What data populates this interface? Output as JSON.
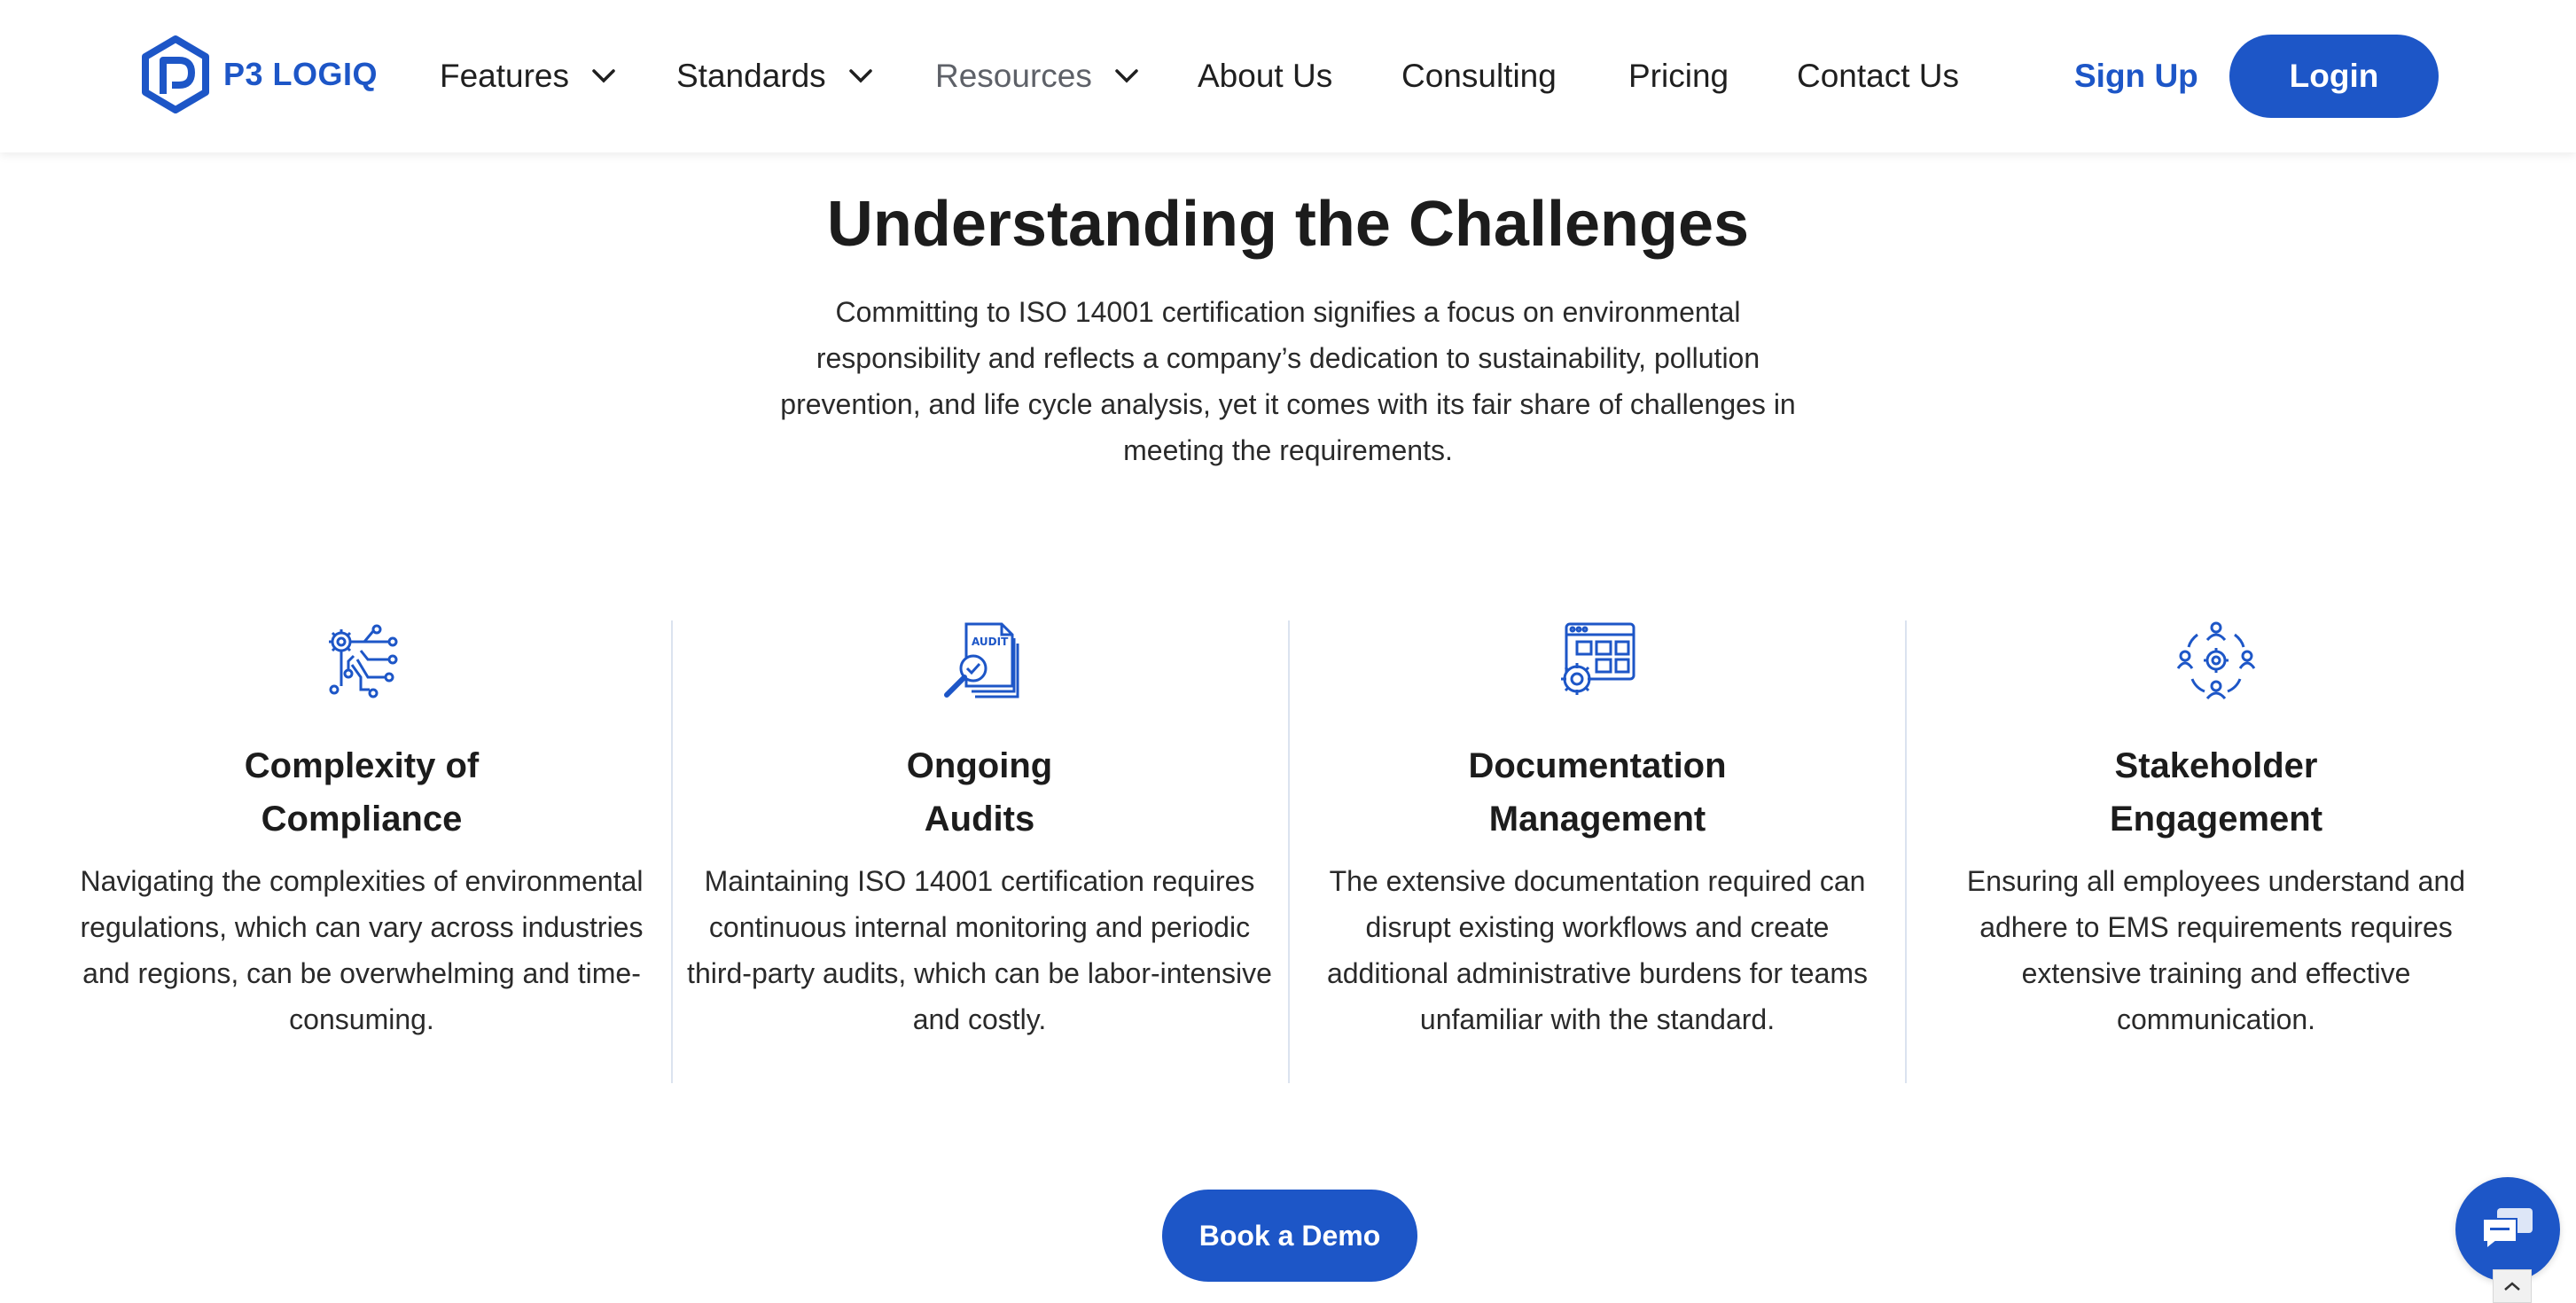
{
  "brand": {
    "name": "P3 LOGIQ",
    "color": "#1d56c7"
  },
  "nav": {
    "items": [
      {
        "label": "Features",
        "has_dropdown": true
      },
      {
        "label": "Standards",
        "has_dropdown": true
      },
      {
        "label": "Resources",
        "has_dropdown": true
      },
      {
        "label": "About Us",
        "has_dropdown": false
      },
      {
        "label": "Consulting",
        "has_dropdown": false
      },
      {
        "label": "Pricing",
        "has_dropdown": false
      },
      {
        "label": "Contact Us",
        "has_dropdown": false
      }
    ],
    "signup_label": "Sign Up",
    "login_label": "Login"
  },
  "section": {
    "title": "Understanding the Challenges",
    "intro": "Committing to ISO 14001 certification signifies a focus on environmental responsibility and reflects a company’s dedication to sustainability, pollution prevention, and life cycle analysis, yet it comes with its fair share of challenges in meeting the requirements.",
    "cards": [
      {
        "icon": "circuit-gear-icon",
        "title_line1": "Complexity of",
        "title_line2": "Compliance",
        "description": "Navigating the complexities of environmental regulations, which can vary across industries and regions, can be overwhelming and time-consuming."
      },
      {
        "icon": "audit-document-icon",
        "icon_text": "AUDIT",
        "title_line1": "Ongoing",
        "title_line2": "Audits",
        "description": "Maintaining ISO 14001 certification requires continuous internal monitoring and periodic third-party audits, which can be labor-intensive and costly."
      },
      {
        "icon": "document-management-icon",
        "title_line1": "Documentation",
        "title_line2": "Management",
        "description": "The extensive documentation required can disrupt existing workflows and create additional administrative burdens for teams unfamiliar with the standard."
      },
      {
        "icon": "stakeholder-network-icon",
        "title_line1": "Stakeholder",
        "title_line2": "Engagement",
        "description": "Ensuring all employees understand and adhere to EMS requirements requires extensive training and effective communication."
      }
    ],
    "cta_label": "Book a Demo"
  },
  "widgets": {
    "chat": "chat-bubble-icon",
    "scroll_top": "chevron-up-icon"
  }
}
